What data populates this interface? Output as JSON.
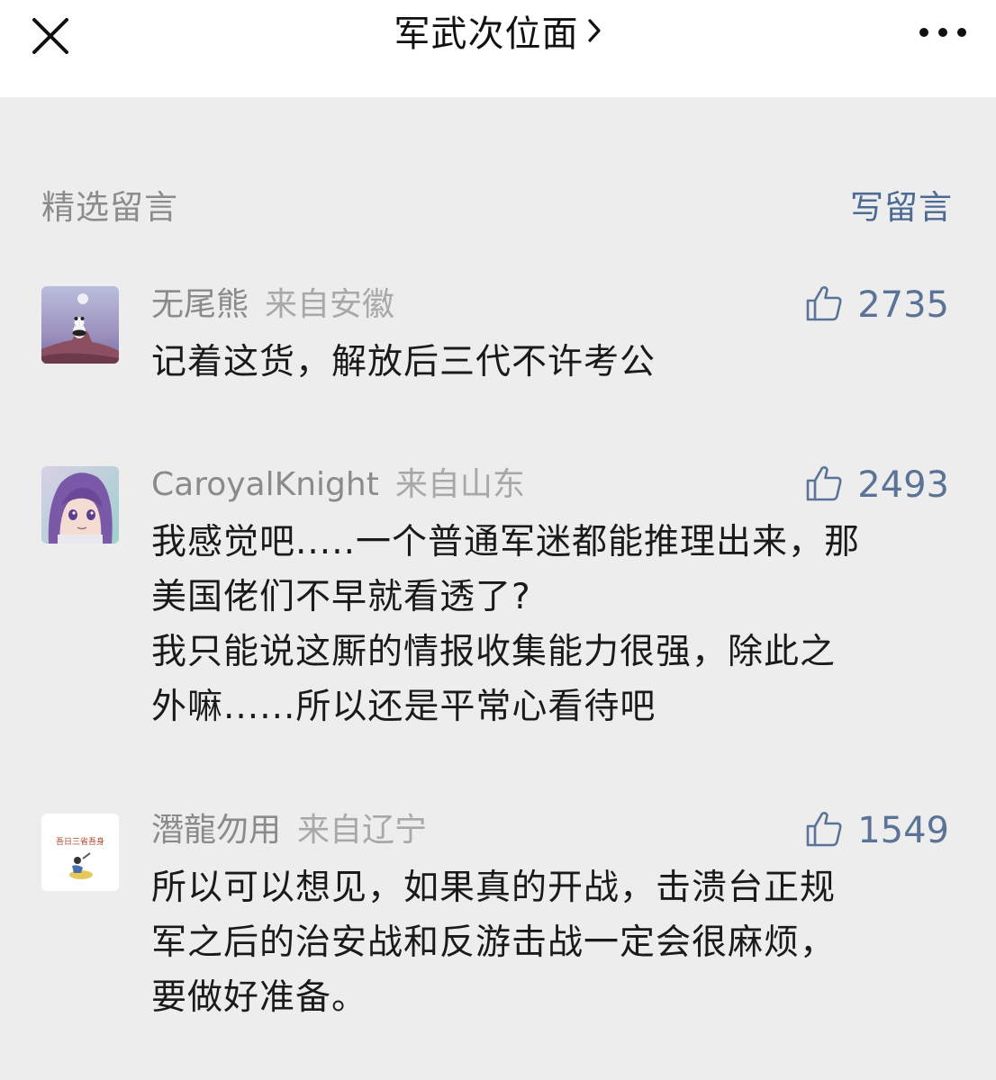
{
  "header": {
    "title": "军武次位面",
    "close_icon": "close-icon",
    "chevron_icon": "chevron-right-icon",
    "more_icon": "more-horizontal-icon"
  },
  "section": {
    "title": "精选留言",
    "write_label": "写留言"
  },
  "colors": {
    "link_blue": "#4c6a93",
    "background": "#ededed"
  },
  "comments": [
    {
      "nickname": "无尾熊",
      "location": "来自安徽",
      "likes": "2735",
      "lines": [
        "记着这货，解放后三代不许考公"
      ]
    },
    {
      "nickname": "CaroyalKnight",
      "location": "来自山东",
      "likes": "2493",
      "lines": [
        "我感觉吧.....一个普通军迷都能推理出来，那",
        "美国佬们不早就看透了?",
        "我只能说这厮的情报收集能力很强，除此之",
        "外嘛......所以还是平常心看待吧"
      ]
    },
    {
      "nickname": "潛龍勿用",
      "location": "来自辽宁",
      "likes": "1549",
      "avatar_text": "吾日三省吾身",
      "lines": [
        "所以可以想见，如果真的开战，击溃台正规",
        "军之后的治安战和反游击战一定会很麻烦，",
        "要做好准备。"
      ]
    }
  ]
}
